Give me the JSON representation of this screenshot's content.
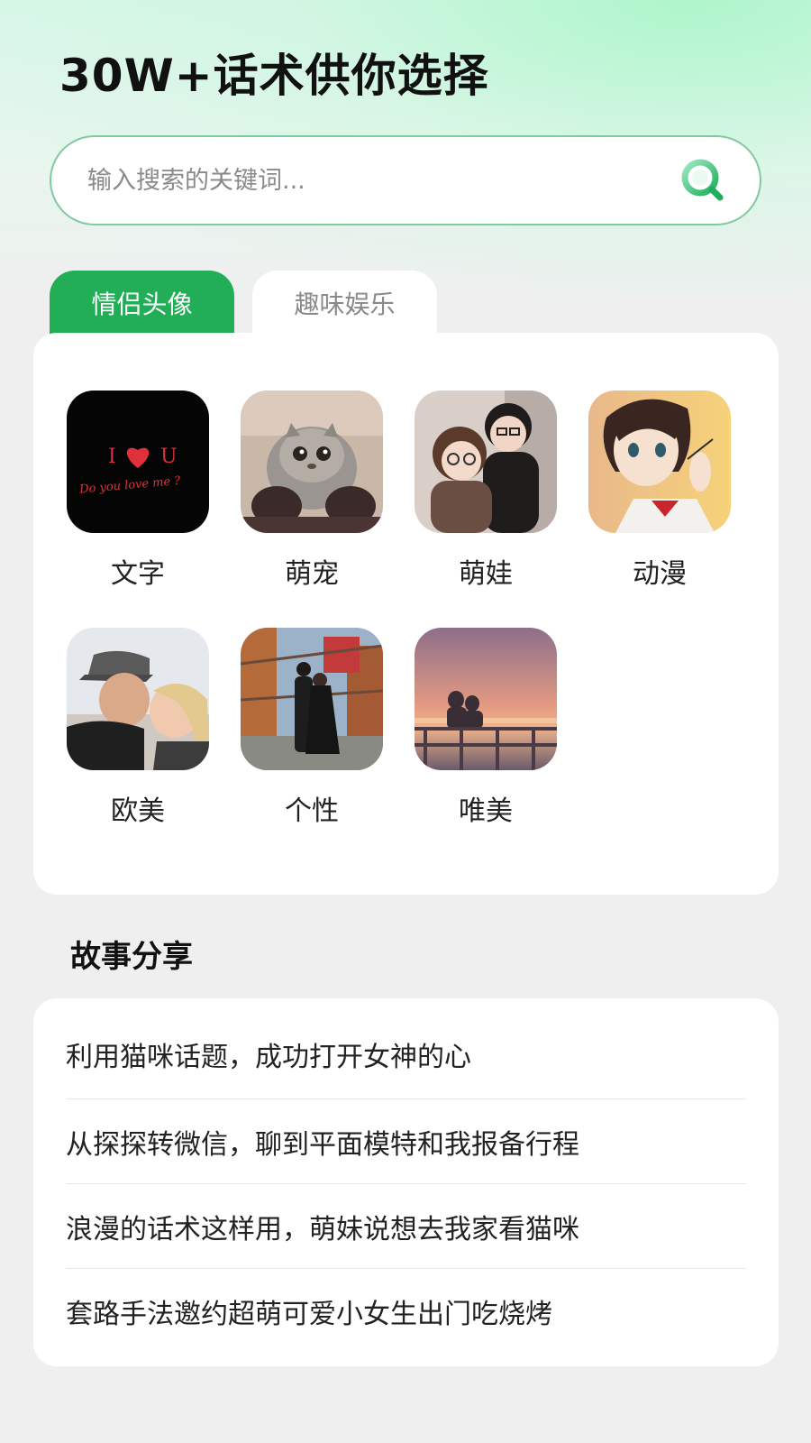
{
  "header": {
    "title": "30W+话术供你选择"
  },
  "search": {
    "placeholder": "输入搜索的关键词...",
    "icon": "search-icon"
  },
  "tabs": [
    {
      "label": "情侣头像",
      "active": true
    },
    {
      "label": "趣味娱乐",
      "active": false
    }
  ],
  "avatar_categories": [
    {
      "label": "文字",
      "thumb_text_1": "I",
      "thumb_text_2": "U",
      "thumb_text_3": "Do you love me ?"
    },
    {
      "label": "萌宠"
    },
    {
      "label": "萌娃"
    },
    {
      "label": "动漫"
    },
    {
      "label": "欧美"
    },
    {
      "label": "个性"
    },
    {
      "label": "唯美"
    }
  ],
  "stories": {
    "title": "故事分享",
    "items": [
      "利用猫咪话题，成功打开女神的心",
      "从探探转微信，聊到平面模特和我报备行程",
      "浪漫的话术这样用，萌妹说想去我家看猫咪",
      "套路手法邀约超萌可爱小女生出门吃烧烤"
    ]
  },
  "colors": {
    "accent": "#22ae57",
    "search_border": "#7fca9e",
    "background": "#efefef"
  }
}
